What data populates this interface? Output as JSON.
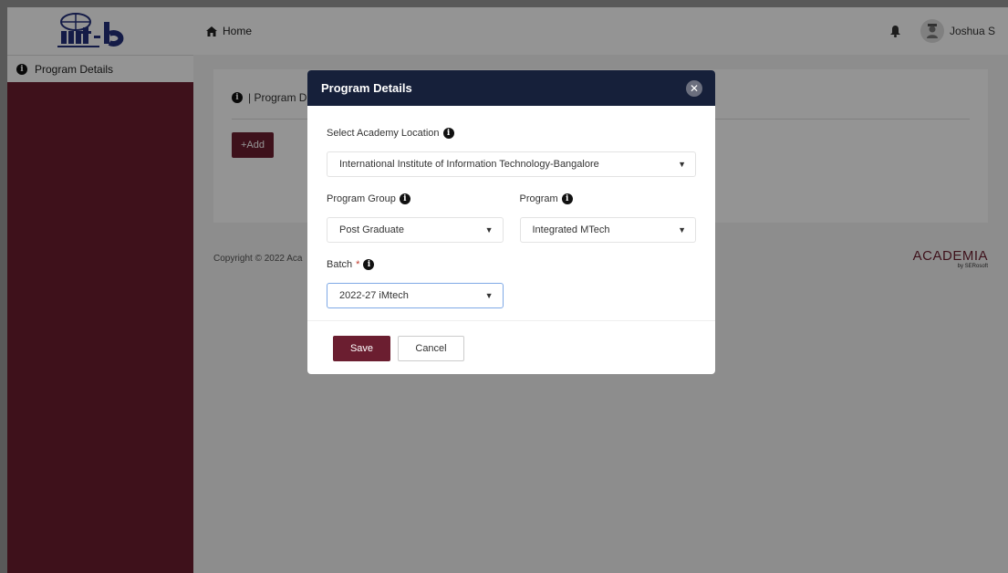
{
  "sidebar": {
    "logo_text": "iiit-b",
    "items": [
      {
        "label": "Program Details",
        "icon": "info-circle-icon"
      }
    ]
  },
  "topbar": {
    "home_label": "Home",
    "home_icon": "home-icon",
    "bell_icon": "bell-icon",
    "user_name": "Joshua S"
  },
  "main": {
    "card_title": "| Program D",
    "add_label": "+Add",
    "copyright": "Copyright © 2022 Aca",
    "brand_name": "ACADEMIA",
    "brand_by": "by SERosoft"
  },
  "modal": {
    "title": "Program Details",
    "close_icon": "close-icon",
    "academy_label": "Select Academy Location",
    "academy_value": "International Institute of Information Technology-Bangalore",
    "program_group_label": "Program Group",
    "program_group_value": "Post Graduate",
    "program_label": "Program",
    "program_value": "Integrated MTech",
    "batch_label": "Batch",
    "batch_required": "*",
    "batch_value": "2022-27 iMtech",
    "save_label": "Save",
    "cancel_label": "Cancel"
  },
  "colors": {
    "brand": "#6b1e30",
    "modal_header": "#16203a"
  }
}
